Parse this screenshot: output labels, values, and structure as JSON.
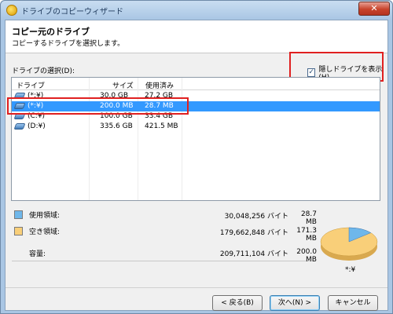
{
  "window": {
    "title": "ドライブのコピーウィザード"
  },
  "header": {
    "title": "コピー元のドライブ",
    "subtitle": "コピーするドライブを選択します。"
  },
  "selection": {
    "label": "ドライブの選択(D):",
    "hidden_checkbox_label": "隠しドライブを表示(H)",
    "hidden_checked": true
  },
  "table": {
    "columns": [
      "ドライブ",
      "サイズ",
      "使用済み"
    ],
    "rows": [
      {
        "drive": "(*:¥)",
        "size": "30.0 GB",
        "used": "27.2 GB"
      },
      {
        "drive": "(*:¥)",
        "size": "200.0 MB",
        "used": "28.7 MB",
        "selected": true
      },
      {
        "drive": "(C:¥)",
        "size": "100.0 GB",
        "used": "33.4 GB"
      },
      {
        "drive": "(D:¥)",
        "size": "335.6 GB",
        "used": "421.5 MB"
      }
    ]
  },
  "legend": {
    "used": {
      "label": "使用領域:",
      "bytes": "30,048,256 バイト",
      "size": "28.7 MB",
      "color": "#6fb7ea"
    },
    "free": {
      "label": "空き領域:",
      "bytes": "179,662,848 バイト",
      "size": "171.3 MB",
      "color": "#f9cf79"
    },
    "capacity": {
      "label": "容量:",
      "bytes": "209,711,104 バイト",
      "size": "200.0 MB"
    }
  },
  "pie": {
    "label": "*:¥",
    "used_fraction": 0.14
  },
  "buttons": {
    "back": "< 戻る(B)",
    "next": "次へ(N) >",
    "cancel": "キャンセル"
  },
  "icons": {
    "app": "app-icon",
    "close": "close-icon",
    "drive": "drive-icon"
  }
}
